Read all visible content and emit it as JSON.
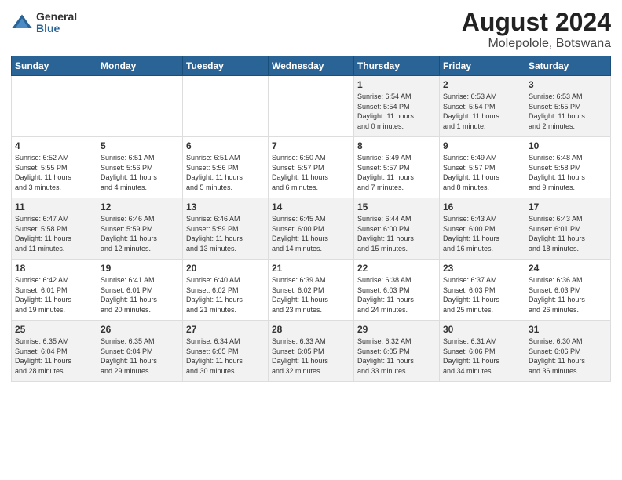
{
  "logo": {
    "general": "General",
    "blue": "Blue"
  },
  "title": "August 2024",
  "subtitle": "Molepolole, Botswana",
  "headers": [
    "Sunday",
    "Monday",
    "Tuesday",
    "Wednesday",
    "Thursday",
    "Friday",
    "Saturday"
  ],
  "weeks": [
    [
      {
        "day": "",
        "info": ""
      },
      {
        "day": "",
        "info": ""
      },
      {
        "day": "",
        "info": ""
      },
      {
        "day": "",
        "info": ""
      },
      {
        "day": "1",
        "info": "Sunrise: 6:54 AM\nSunset: 5:54 PM\nDaylight: 11 hours\nand 0 minutes."
      },
      {
        "day": "2",
        "info": "Sunrise: 6:53 AM\nSunset: 5:54 PM\nDaylight: 11 hours\nand 1 minute."
      },
      {
        "day": "3",
        "info": "Sunrise: 6:53 AM\nSunset: 5:55 PM\nDaylight: 11 hours\nand 2 minutes."
      }
    ],
    [
      {
        "day": "4",
        "info": "Sunrise: 6:52 AM\nSunset: 5:55 PM\nDaylight: 11 hours\nand 3 minutes."
      },
      {
        "day": "5",
        "info": "Sunrise: 6:51 AM\nSunset: 5:56 PM\nDaylight: 11 hours\nand 4 minutes."
      },
      {
        "day": "6",
        "info": "Sunrise: 6:51 AM\nSunset: 5:56 PM\nDaylight: 11 hours\nand 5 minutes."
      },
      {
        "day": "7",
        "info": "Sunrise: 6:50 AM\nSunset: 5:57 PM\nDaylight: 11 hours\nand 6 minutes."
      },
      {
        "day": "8",
        "info": "Sunrise: 6:49 AM\nSunset: 5:57 PM\nDaylight: 11 hours\nand 7 minutes."
      },
      {
        "day": "9",
        "info": "Sunrise: 6:49 AM\nSunset: 5:57 PM\nDaylight: 11 hours\nand 8 minutes."
      },
      {
        "day": "10",
        "info": "Sunrise: 6:48 AM\nSunset: 5:58 PM\nDaylight: 11 hours\nand 9 minutes."
      }
    ],
    [
      {
        "day": "11",
        "info": "Sunrise: 6:47 AM\nSunset: 5:58 PM\nDaylight: 11 hours\nand 11 minutes."
      },
      {
        "day": "12",
        "info": "Sunrise: 6:46 AM\nSunset: 5:59 PM\nDaylight: 11 hours\nand 12 minutes."
      },
      {
        "day": "13",
        "info": "Sunrise: 6:46 AM\nSunset: 5:59 PM\nDaylight: 11 hours\nand 13 minutes."
      },
      {
        "day": "14",
        "info": "Sunrise: 6:45 AM\nSunset: 6:00 PM\nDaylight: 11 hours\nand 14 minutes."
      },
      {
        "day": "15",
        "info": "Sunrise: 6:44 AM\nSunset: 6:00 PM\nDaylight: 11 hours\nand 15 minutes."
      },
      {
        "day": "16",
        "info": "Sunrise: 6:43 AM\nSunset: 6:00 PM\nDaylight: 11 hours\nand 16 minutes."
      },
      {
        "day": "17",
        "info": "Sunrise: 6:43 AM\nSunset: 6:01 PM\nDaylight: 11 hours\nand 18 minutes."
      }
    ],
    [
      {
        "day": "18",
        "info": "Sunrise: 6:42 AM\nSunset: 6:01 PM\nDaylight: 11 hours\nand 19 minutes."
      },
      {
        "day": "19",
        "info": "Sunrise: 6:41 AM\nSunset: 6:01 PM\nDaylight: 11 hours\nand 20 minutes."
      },
      {
        "day": "20",
        "info": "Sunrise: 6:40 AM\nSunset: 6:02 PM\nDaylight: 11 hours\nand 21 minutes."
      },
      {
        "day": "21",
        "info": "Sunrise: 6:39 AM\nSunset: 6:02 PM\nDaylight: 11 hours\nand 23 minutes."
      },
      {
        "day": "22",
        "info": "Sunrise: 6:38 AM\nSunset: 6:03 PM\nDaylight: 11 hours\nand 24 minutes."
      },
      {
        "day": "23",
        "info": "Sunrise: 6:37 AM\nSunset: 6:03 PM\nDaylight: 11 hours\nand 25 minutes."
      },
      {
        "day": "24",
        "info": "Sunrise: 6:36 AM\nSunset: 6:03 PM\nDaylight: 11 hours\nand 26 minutes."
      }
    ],
    [
      {
        "day": "25",
        "info": "Sunrise: 6:35 AM\nSunset: 6:04 PM\nDaylight: 11 hours\nand 28 minutes."
      },
      {
        "day": "26",
        "info": "Sunrise: 6:35 AM\nSunset: 6:04 PM\nDaylight: 11 hours\nand 29 minutes."
      },
      {
        "day": "27",
        "info": "Sunrise: 6:34 AM\nSunset: 6:05 PM\nDaylight: 11 hours\nand 30 minutes."
      },
      {
        "day": "28",
        "info": "Sunrise: 6:33 AM\nSunset: 6:05 PM\nDaylight: 11 hours\nand 32 minutes."
      },
      {
        "day": "29",
        "info": "Sunrise: 6:32 AM\nSunset: 6:05 PM\nDaylight: 11 hours\nand 33 minutes."
      },
      {
        "day": "30",
        "info": "Sunrise: 6:31 AM\nSunset: 6:06 PM\nDaylight: 11 hours\nand 34 minutes."
      },
      {
        "day": "31",
        "info": "Sunrise: 6:30 AM\nSunset: 6:06 PM\nDaylight: 11 hours\nand 36 minutes."
      }
    ]
  ]
}
